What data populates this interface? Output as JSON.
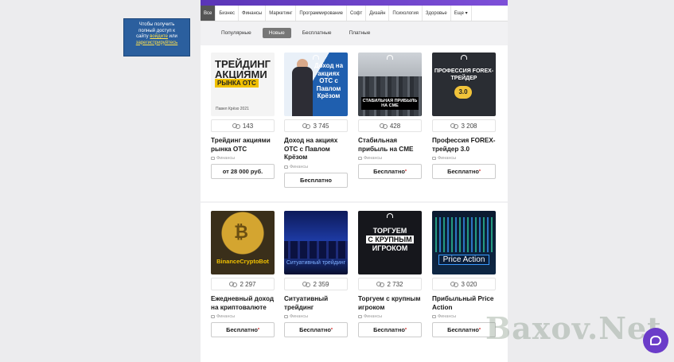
{
  "promo": {
    "line1": "Чтобы получить",
    "line2": "полный доступ к",
    "line3_pre": "сайту ",
    "login": "войдите",
    "line3_mid": " или",
    "register": "зарегистрируйтесь"
  },
  "nav": {
    "items": [
      "Все",
      "Бизнес",
      "Финансы",
      "Маркетинг",
      "Программирование",
      "Софт",
      "Дизайн",
      "Психология",
      "Здоровье",
      "Еще ▾"
    ]
  },
  "filters": [
    "Популярные",
    "Новые",
    "Бесплатные",
    "Платные"
  ],
  "colors": {
    "accent": "#6b3cc9",
    "nav_active": "#555555",
    "promo_bg": "#2b5f9e"
  },
  "cards": [
    {
      "title": "Трейдинг акциями рынка OTC",
      "count": "143",
      "category": "Финансы",
      "price": "от 28 000 руб.",
      "thumb": {
        "l1": "ТРЕЙДИНГ",
        "l2": "АКЦИЯМИ",
        "band": "РЫНКА OTC",
        "foot": "Павел Крёзо 2021"
      }
    },
    {
      "title": "Доход на акциях OTC с Павлом Крёзом",
      "count": "3 745",
      "category": "Финансы",
      "price": "Бесплатно",
      "thumb": {
        "text": "Доход на акциях OTC с Павлом Крёзом"
      }
    },
    {
      "title": "Стабильная прибыль на CME",
      "count": "428",
      "category": "Финансы",
      "price": "Бесплатно",
      "price_mark": "*",
      "thumb": {
        "text": "СТАБИЛЬНАЯ ПРИБЫЛЬ НА CME"
      }
    },
    {
      "title": "Профессия FOREX-трейдер 3.0",
      "count": "3 208",
      "category": "Финансы",
      "price": "Бесплатно",
      "price_mark": "*",
      "thumb": {
        "text": "ПРОФЕССИЯ FOREX-ТРЕЙДЕР",
        "badge": "3.0"
      }
    },
    {
      "title": "Ежедневный доход на криптовалюте",
      "count": "2 297",
      "category": "Финансы",
      "price": "Бесплатно",
      "price_mark": "*",
      "thumb": {
        "text": "BinanceCryptoBot"
      }
    },
    {
      "title": "Ситуативный трейдинг",
      "count": "2 359",
      "category": "Финансы",
      "price": "Бесплатно",
      "price_mark": "*",
      "thumb": {
        "text": "Ситуативный трейдинг"
      }
    },
    {
      "title": "Торгуем с крупным игроком",
      "count": "2 732",
      "category": "Финансы",
      "price": "Бесплатно",
      "price_mark": "*",
      "thumb": {
        "l1": "ТОРГУЕМ",
        "l2": "С КРУПНЫМ",
        "l3": "ИГРОКОМ"
      }
    },
    {
      "title": "Прибыльный Price Action",
      "count": "3 020",
      "category": "Финансы",
      "price": "Бесплатно",
      "price_mark": "*",
      "thumb": {
        "text": "Price Action"
      }
    }
  ],
  "watermark": "Baxov.Net"
}
